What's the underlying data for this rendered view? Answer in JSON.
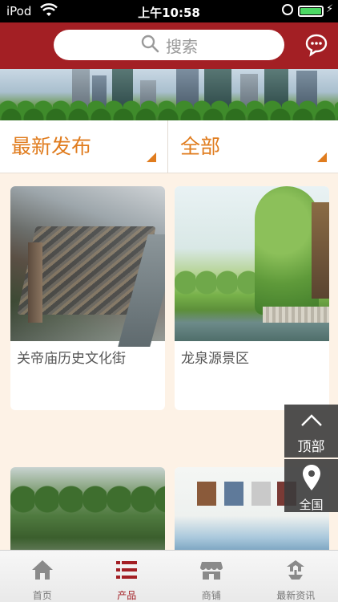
{
  "status_bar": {
    "carrier": "iPod",
    "time": "上午10:58"
  },
  "header": {
    "search_placeholder": "搜索"
  },
  "filters": {
    "sort_label": "最新发布",
    "region_label": "全部"
  },
  "cards": [
    {
      "title": "关帝庙历史文化街"
    },
    {
      "title": "龙泉源景区"
    },
    {
      "title": ""
    },
    {
      "title": ""
    }
  ],
  "floating": {
    "top_label": "顶部",
    "all_label": "全国"
  },
  "tabbar": {
    "active": "产品",
    "items": [
      {
        "label": "首页",
        "icon": "home-icon"
      },
      {
        "label": "产品",
        "icon": "list-icon"
      },
      {
        "label": "商铺",
        "icon": "shop-icon"
      },
      {
        "label": "最新资讯",
        "icon": "news-icon"
      }
    ]
  },
  "colors": {
    "brand": "#a31f24",
    "accent": "#e07c1e",
    "background": "#fdf2e6"
  }
}
